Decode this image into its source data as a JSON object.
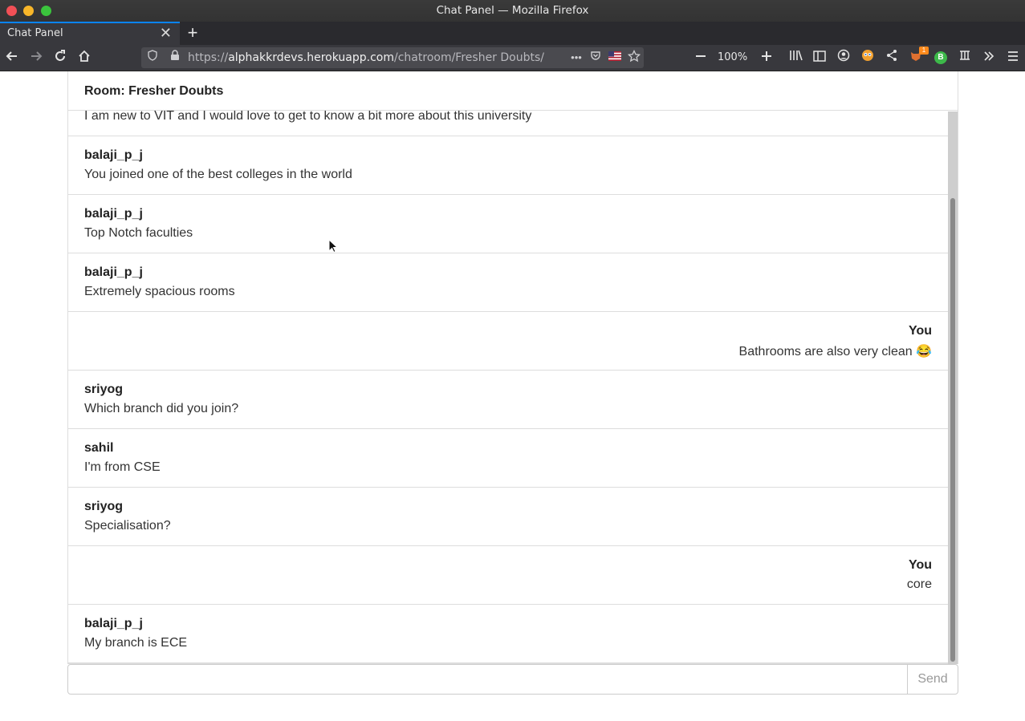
{
  "window": {
    "title": "Chat Panel — Mozilla Firefox"
  },
  "tab": {
    "title": "Chat Panel",
    "close": "✕",
    "new": "+"
  },
  "nav": {
    "url_prefix": "https://",
    "url_host": "alphakkrdevs.herokuapp.com",
    "url_path": "/chatroom/Fresher Doubts/",
    "zoom": "100%",
    "badge_count": "1",
    "profile_letter": "B"
  },
  "page": {
    "room_title": "Room: Fresher Doubts",
    "partial_message": "I am new to VIT and I would love to get to know a bit more about this university",
    "messages": [
      {
        "author": "balaji_p_j",
        "text": "You joined one of the best colleges in the world",
        "align": "left"
      },
      {
        "author": "balaji_p_j",
        "text": "Top Notch faculties",
        "align": "left"
      },
      {
        "author": "balaji_p_j",
        "text": "Extremely spacious rooms",
        "align": "left"
      },
      {
        "author": "You",
        "text": "Bathrooms are also very clean 😂",
        "align": "right"
      },
      {
        "author": "sriyog",
        "text": "Which branch did you join?",
        "align": "left"
      },
      {
        "author": "sahil",
        "text": "I'm from CSE",
        "align": "left"
      },
      {
        "author": "sriyog",
        "text": "Specialisation?",
        "align": "left"
      },
      {
        "author": "You",
        "text": "core",
        "align": "right"
      },
      {
        "author": "balaji_p_j",
        "text": "My branch is ECE",
        "align": "left"
      }
    ],
    "input_value": "",
    "send_label": "Send"
  }
}
